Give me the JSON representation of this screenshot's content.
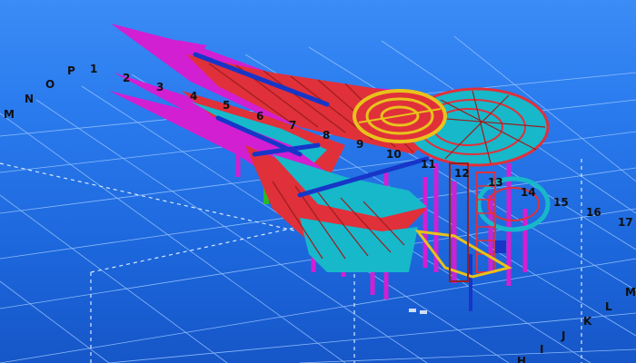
{
  "viewport": {
    "background_top": "#3b8cf6",
    "background_bottom": "#1656c8",
    "grid_color": "#9ec8ff",
    "structure_colors": {
      "primary": "#e0303a",
      "secondary": "#d21fd2",
      "tertiary": "#17b8c9",
      "beam": "#1736c8",
      "accent": "#e8c21b",
      "highlight": "#2bb82b"
    }
  },
  "grid_labels": {
    "letters_left": [
      "M",
      "N",
      "O",
      "P"
    ],
    "numbers_top": [
      "1",
      "2",
      "3",
      "4",
      "5",
      "6",
      "7",
      "8",
      "9",
      "10",
      "11",
      "12",
      "13",
      "14",
      "15",
      "16",
      "17"
    ],
    "letters_right": [
      "M",
      "L",
      "K",
      "J",
      "I",
      "H"
    ]
  }
}
